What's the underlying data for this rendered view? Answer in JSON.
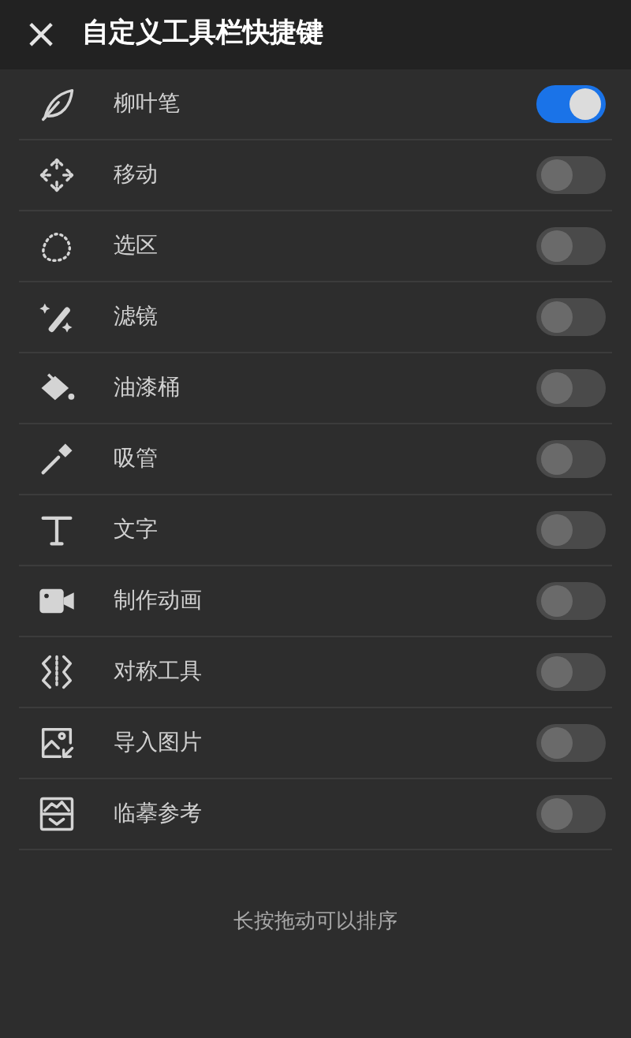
{
  "header": {
    "close": "×",
    "title": "自定义工具栏快捷键"
  },
  "tools": [
    {
      "label": "柳叶笔",
      "on": true
    },
    {
      "label": "移动",
      "on": false
    },
    {
      "label": "选区",
      "on": false
    },
    {
      "label": "滤镜",
      "on": false
    },
    {
      "label": "油漆桶",
      "on": false
    },
    {
      "label": "吸管",
      "on": false
    },
    {
      "label": "文字",
      "on": false
    },
    {
      "label": "制作动画",
      "on": false
    },
    {
      "label": "对称工具",
      "on": false
    },
    {
      "label": "导入图片",
      "on": false
    },
    {
      "label": "临摹参考",
      "on": false
    }
  ],
  "hint": "长按拖动可以排序"
}
